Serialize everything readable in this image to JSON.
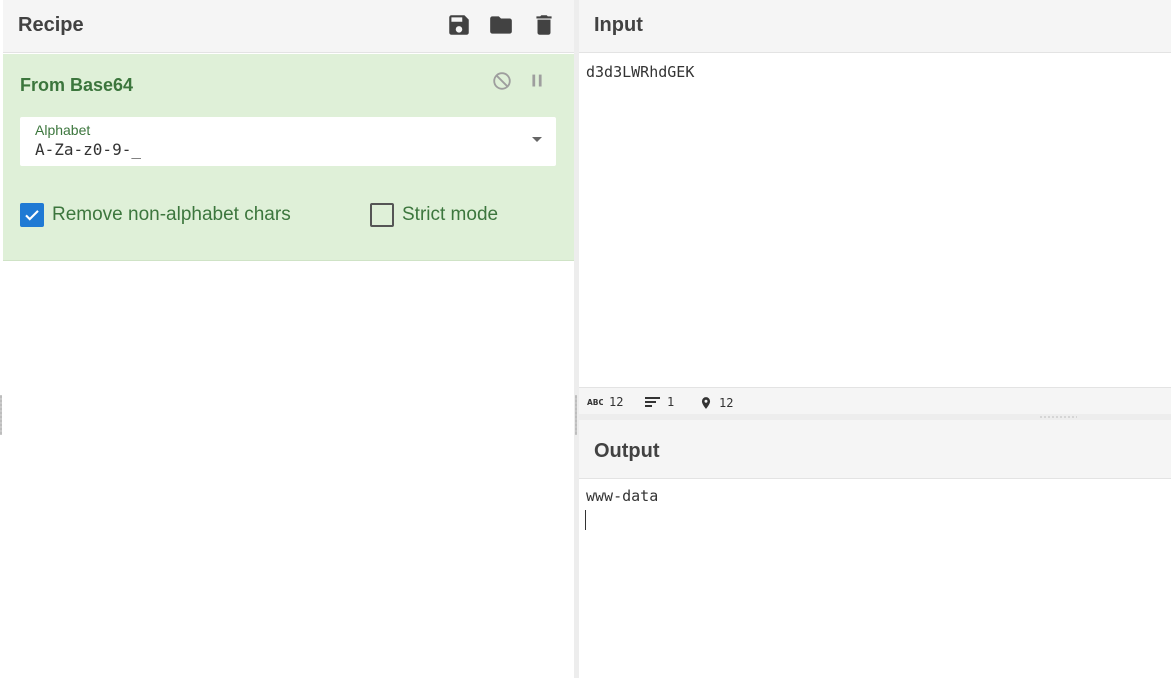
{
  "recipe": {
    "title": "Recipe",
    "icons": [
      "save-icon",
      "folder-open-icon",
      "trash-icon"
    ]
  },
  "operation": {
    "name": "From Base64",
    "icons": [
      "disable-icon",
      "pause-icon"
    ],
    "alphabet": {
      "label": "Alphabet",
      "value": "A-Za-z0-9-_"
    },
    "options": [
      {
        "label": "Remove non-alphabet chars",
        "checked": true
      },
      {
        "label": "Strict mode",
        "checked": false
      }
    ],
    "colors": {
      "background": "#dff0d8",
      "text": "#3c763d",
      "checkbox": "#1f7ad4"
    }
  },
  "input": {
    "title": "Input",
    "text": "d3d3LWRhdGEK",
    "status": {
      "length": "12",
      "lines": "1",
      "position": "12"
    }
  },
  "output": {
    "title": "Output",
    "text": "www-data"
  }
}
